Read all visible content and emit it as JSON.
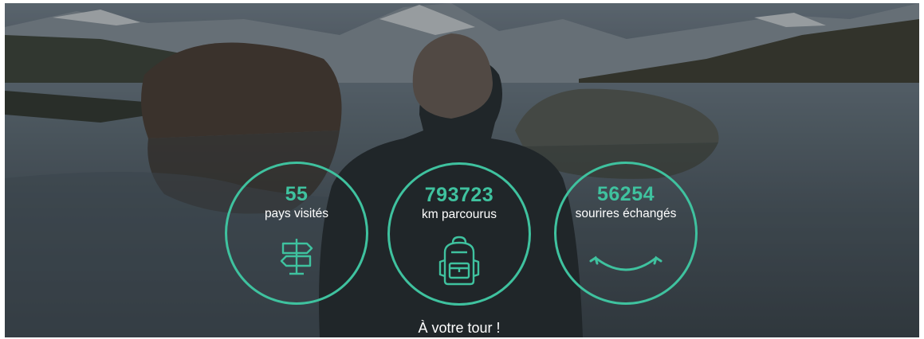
{
  "stats": [
    {
      "value": "55",
      "label": "pays visités",
      "icon": "signpost-icon"
    },
    {
      "value": "793723",
      "label": "km parcourus",
      "icon": "backpack-icon"
    },
    {
      "value": "56254",
      "label": "sourires échangés",
      "icon": "smile-icon"
    }
  ],
  "cta": {
    "label": "À votre tour !"
  },
  "colors": {
    "accent": "#3fc29f",
    "text": "#ffffff",
    "overlay": "#2c3236"
  }
}
